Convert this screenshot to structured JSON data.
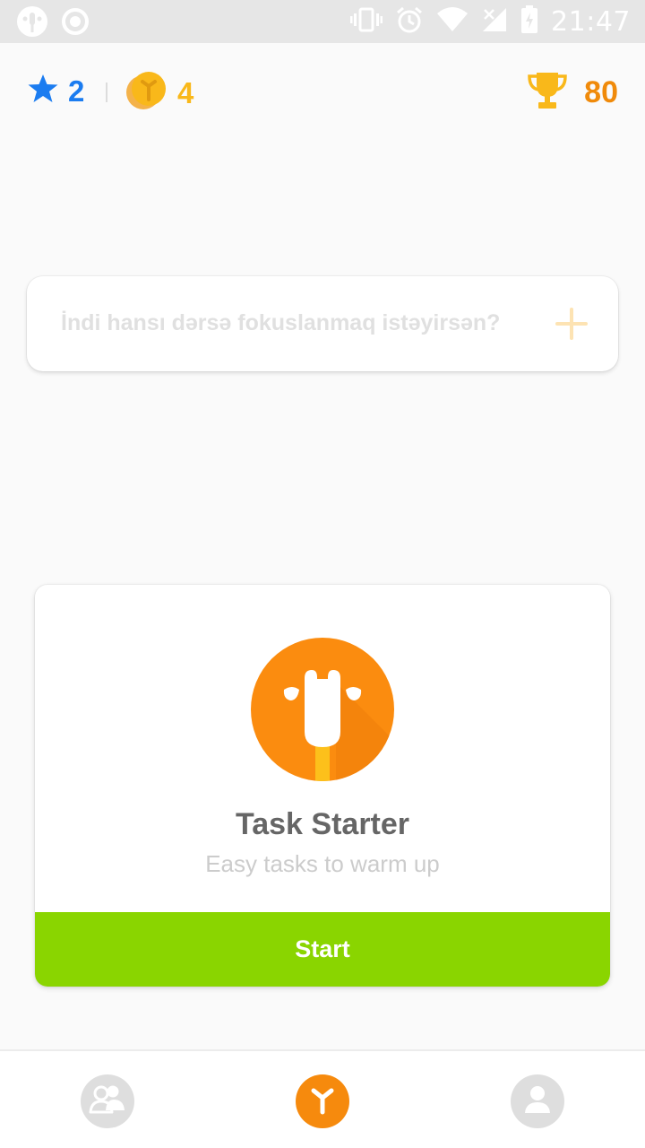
{
  "status_bar": {
    "time": "21:47"
  },
  "header": {
    "stars_count": "2",
    "coins_count": "4",
    "trophy_count": "80"
  },
  "focus_input": {
    "placeholder": "İndi hansı dərsə fokuslanmaq istəyirsən?"
  },
  "task_card": {
    "title": "Task Starter",
    "subtitle": "Easy tasks to warm up",
    "button_label": "Start"
  },
  "colors": {
    "accent_orange": "#f68a0d",
    "star_blue": "#1b7cf0",
    "coin_yellow": "#f9b81a",
    "start_green": "#8ad500"
  },
  "bottom_nav": {
    "items": [
      "friends-icon",
      "home-focus-icon",
      "profile-icon"
    ]
  }
}
